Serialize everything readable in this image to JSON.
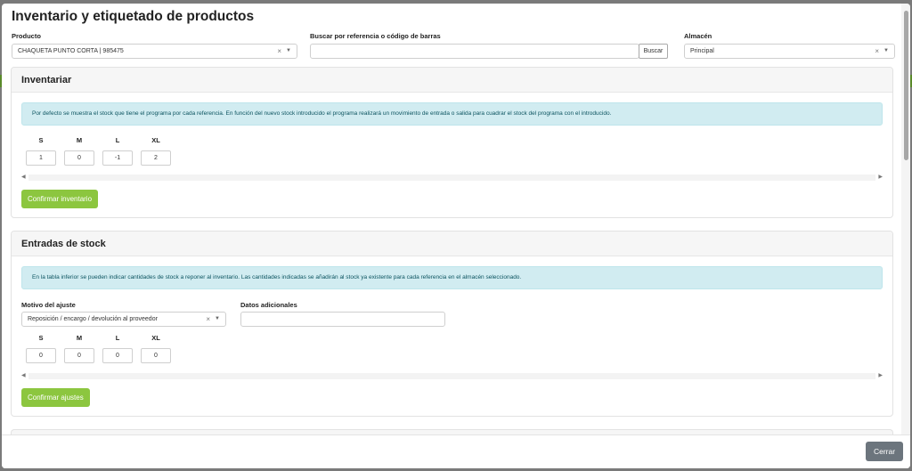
{
  "modal": {
    "title": "Inventario y etiquetado de productos",
    "close_label": "Cerrar"
  },
  "filters": {
    "product_label": "Producto",
    "product_value": "CHAQUETA PUNTO CORTA | 985475",
    "search_label": "Buscar por referencia o código de barras",
    "search_value": "",
    "search_button": "Buscar",
    "warehouse_label": "Almacén",
    "warehouse_value": "Principal",
    "clear_symbol": "×",
    "caret_symbol": "▼"
  },
  "inventory": {
    "title": "Inventariar",
    "info": "Por defecto se muestra el stock que tiene el programa por cada referencia. En función del nuevo stock introducido el programa realizará un movimiento de entrada o salida para cuadrar el stock del programa con el introducido.",
    "sizes": [
      {
        "label": "S",
        "value": "1"
      },
      {
        "label": "M",
        "value": "0"
      },
      {
        "label": "L",
        "value": "-1"
      },
      {
        "label": "XL",
        "value": "2"
      }
    ],
    "confirm_button": "Confirmar inventario"
  },
  "stock_entries": {
    "title": "Entradas de stock",
    "info": "En la tabla inferior se pueden indicar cantidades de stock a reponer al inventario. Las cantidades indicadas se añadirán al stock ya existente para cada referencia en el almacén seleccionado.",
    "reason_label": "Motivo del ajuste",
    "reason_value": "Reposición / encargo / devolución al proveedor",
    "extra_label": "Datos adicionales",
    "extra_value": "",
    "sizes": [
      {
        "label": "S",
        "value": "0"
      },
      {
        "label": "M",
        "value": "0"
      },
      {
        "label": "L",
        "value": "0"
      },
      {
        "label": "XL",
        "value": "0"
      }
    ],
    "confirm_button": "Confirmar ajustes"
  },
  "scroll": {
    "left_arrow": "◀",
    "right_arrow": "▶"
  }
}
